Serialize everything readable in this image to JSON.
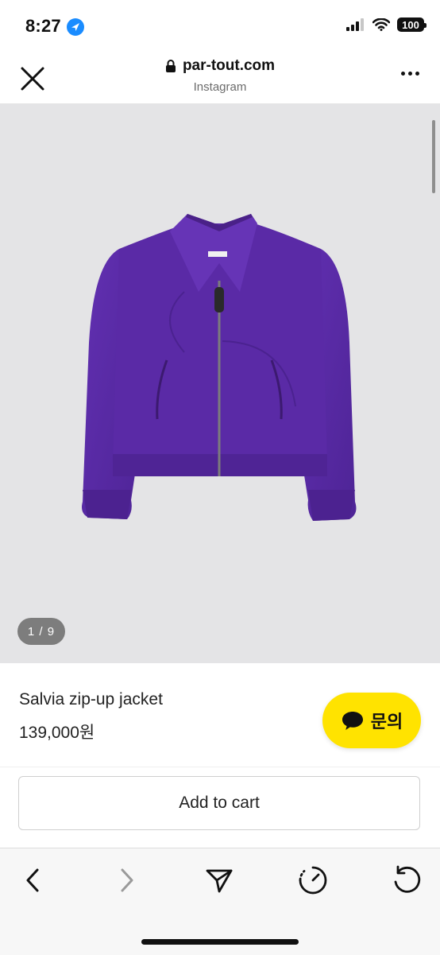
{
  "status_bar": {
    "time": "8:27",
    "battery": "100",
    "icons": [
      "location-arrow-icon",
      "signal-bars-icon",
      "wifi-icon",
      "battery-icon"
    ]
  },
  "browser": {
    "domain": "par-tout.com",
    "subtitle": "Instagram",
    "icons": [
      "close-icon",
      "lock-icon",
      "more-icon"
    ]
  },
  "gallery": {
    "pager": "1 / 9",
    "background": "#e4e4e6"
  },
  "product": {
    "name": "Salvia zip-up jacket",
    "price": "139,000원",
    "jacket_color": "#5a2aa6"
  },
  "chat": {
    "label": "문의",
    "color": "#ffe300"
  },
  "cart": {
    "label": "Add to cart"
  },
  "toolbar": {
    "icons": [
      "back-icon",
      "forward-icon",
      "share-icon",
      "history-icon",
      "reload-icon"
    ]
  }
}
